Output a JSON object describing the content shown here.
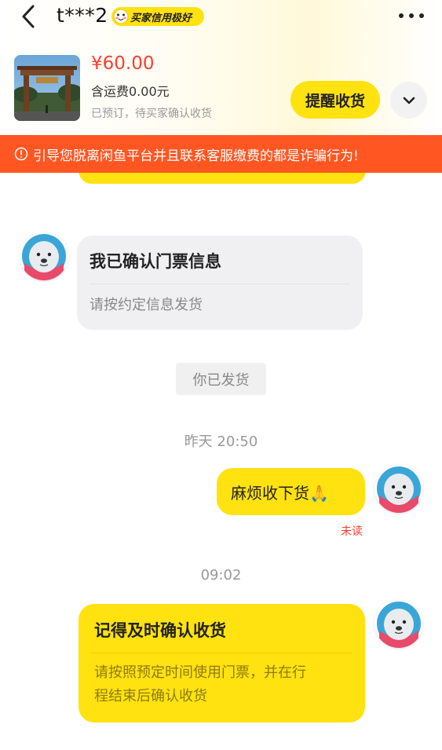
{
  "header": {
    "nickname": "t***2",
    "credit_badge": "买家信用极好"
  },
  "order": {
    "price": "¥60.00",
    "shipping": "含运费0.00元",
    "status": "已预订，待买家确认收货",
    "remind_button": "提醒收货"
  },
  "warning": {
    "text": "引导您脱离闲鱼平台并且联系客服缴费的都是诈骗行为!"
  },
  "messages": {
    "confirm_card": {
      "title": "我已确认门票信息",
      "body": "请按约定信息发货"
    },
    "system_notice": "你已发货",
    "time_yesterday": "昨天 20:50",
    "my_message": {
      "text": "麻烦收下货🙏",
      "read_status": "未读"
    },
    "time_today": "09:02",
    "reminder_card": {
      "title": "记得及时确认收货",
      "body_line1": "请按照预定时间使用门票，并在行",
      "body_line2": "程结束后确认收货"
    }
  },
  "colors": {
    "accent_yellow": "#ffe20f",
    "warning_orange": "#ff5622",
    "price_red": "#ff3b2f"
  },
  "icons": [
    "back-arrow-icon",
    "more-icon",
    "chevron-down-icon",
    "warning-icon",
    "seal-avatar-icon"
  ]
}
